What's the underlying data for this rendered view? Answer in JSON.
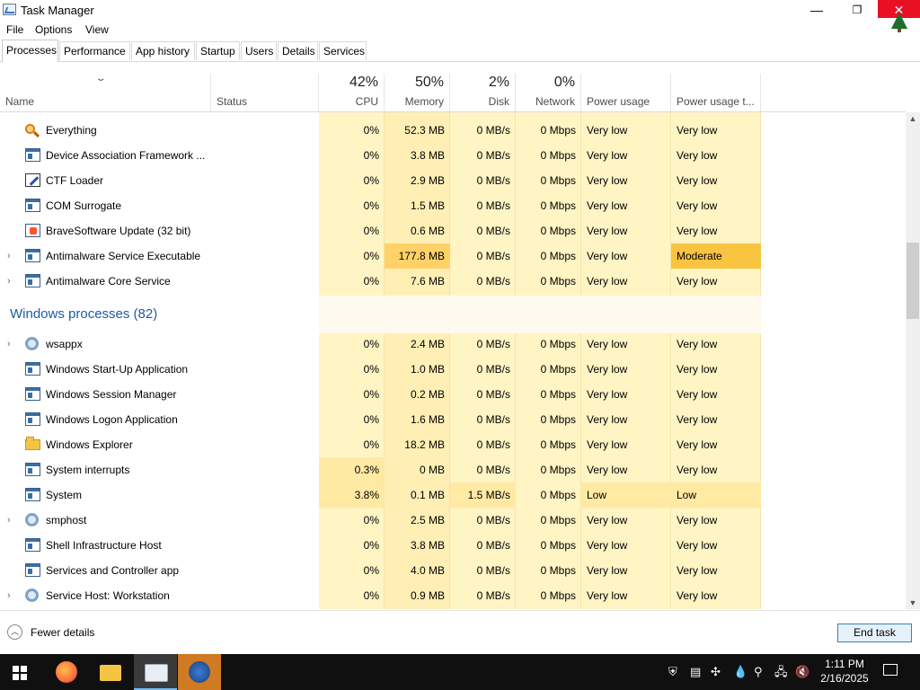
{
  "window": {
    "title": "Task Manager",
    "minimize": "—",
    "maximize": "❐",
    "close": "✕"
  },
  "menu": [
    "File",
    "Options",
    "View"
  ],
  "tabs": [
    "Processes",
    "Performance",
    "App history",
    "Startup",
    "Users",
    "Details",
    "Services"
  ],
  "active_tab": "Processes",
  "columns": {
    "name": "Name",
    "status": "Status",
    "cpu": {
      "pct": "42%",
      "label": "CPU"
    },
    "memory": {
      "pct": "50%",
      "label": "Memory"
    },
    "disk": {
      "pct": "2%",
      "label": "Disk"
    },
    "network": {
      "pct": "0%",
      "label": "Network"
    },
    "power": "Power usage",
    "power_trend": "Power usage t..."
  },
  "rows": [
    {
      "expand": false,
      "icon": "search-icon",
      "name": "Everything",
      "cpu": "0%",
      "mem": "52.3 MB",
      "disk": "0 MB/s",
      "net": "0 Mbps",
      "power": "Very low",
      "trend": "Very low"
    },
    {
      "expand": false,
      "icon": "window-icon",
      "name": "Device Association Framework ...",
      "cpu": "0%",
      "mem": "3.8 MB",
      "disk": "0 MB/s",
      "net": "0 Mbps",
      "power": "Very low",
      "trend": "Very low"
    },
    {
      "expand": false,
      "icon": "edit-icon",
      "name": "CTF Loader",
      "cpu": "0%",
      "mem": "2.9 MB",
      "disk": "0 MB/s",
      "net": "0 Mbps",
      "power": "Very low",
      "trend": "Very low"
    },
    {
      "expand": false,
      "icon": "window-icon",
      "name": "COM Surrogate",
      "cpu": "0%",
      "mem": "1.5 MB",
      "disk": "0 MB/s",
      "net": "0 Mbps",
      "power": "Very low",
      "trend": "Very low"
    },
    {
      "expand": false,
      "icon": "brave-icon",
      "name": "BraveSoftware Update (32 bit)",
      "cpu": "0%",
      "mem": "0.6 MB",
      "disk": "0 MB/s",
      "net": "0 Mbps",
      "power": "Very low",
      "trend": "Very low"
    },
    {
      "expand": true,
      "icon": "window-icon",
      "name": "Antimalware Service Executable",
      "cpu": "0%",
      "mem": "177.8 MB",
      "disk": "0 MB/s",
      "net": "0 Mbps",
      "power": "Very low",
      "trend": "Moderate"
    },
    {
      "expand": true,
      "icon": "window-icon",
      "name": "Antimalware Core Service",
      "cpu": "0%",
      "mem": "7.6 MB",
      "disk": "0 MB/s",
      "net": "0 Mbps",
      "power": "Very low",
      "trend": "Very low"
    }
  ],
  "group": {
    "title": "Windows processes (82)"
  },
  "rows2": [
    {
      "expand": true,
      "icon": "gear-icon",
      "name": "wsappx",
      "cpu": "0%",
      "mem": "2.4 MB",
      "disk": "0 MB/s",
      "net": "0 Mbps",
      "power": "Very low",
      "trend": "Very low"
    },
    {
      "expand": false,
      "icon": "window-icon",
      "name": "Windows Start-Up Application",
      "cpu": "0%",
      "mem": "1.0 MB",
      "disk": "0 MB/s",
      "net": "0 Mbps",
      "power": "Very low",
      "trend": "Very low"
    },
    {
      "expand": false,
      "icon": "window-icon",
      "name": "Windows Session Manager",
      "cpu": "0%",
      "mem": "0.2 MB",
      "disk": "0 MB/s",
      "net": "0 Mbps",
      "power": "Very low",
      "trend": "Very low"
    },
    {
      "expand": false,
      "icon": "window-icon",
      "name": "Windows Logon Application",
      "cpu": "0%",
      "mem": "1.6 MB",
      "disk": "0 MB/s",
      "net": "0 Mbps",
      "power": "Very low",
      "trend": "Very low"
    },
    {
      "expand": false,
      "icon": "folder-icon",
      "name": "Windows Explorer",
      "cpu": "0%",
      "mem": "18.2 MB",
      "disk": "0 MB/s",
      "net": "0 Mbps",
      "power": "Very low",
      "trend": "Very low"
    },
    {
      "expand": false,
      "icon": "window-icon",
      "name": "System interrupts",
      "cpu": "0.3%",
      "mem": "0 MB",
      "disk": "0 MB/s",
      "net": "0 Mbps",
      "power": "Very low",
      "trend": "Very low"
    },
    {
      "expand": false,
      "icon": "window-icon",
      "name": "System",
      "cpu": "3.8%",
      "mem": "0.1 MB",
      "disk": "1.5 MB/s",
      "net": "0 Mbps",
      "power": "Low",
      "trend": "Low"
    },
    {
      "expand": true,
      "icon": "gear-icon",
      "name": "smphost",
      "cpu": "0%",
      "mem": "2.5 MB",
      "disk": "0 MB/s",
      "net": "0 Mbps",
      "power": "Very low",
      "trend": "Very low"
    },
    {
      "expand": false,
      "icon": "window-icon",
      "name": "Shell Infrastructure Host",
      "cpu": "0%",
      "mem": "3.8 MB",
      "disk": "0 MB/s",
      "net": "0 Mbps",
      "power": "Very low",
      "trend": "Very low"
    },
    {
      "expand": false,
      "icon": "window-icon",
      "name": "Services and Controller app",
      "cpu": "0%",
      "mem": "4.0 MB",
      "disk": "0 MB/s",
      "net": "0 Mbps",
      "power": "Very low",
      "trend": "Very low"
    },
    {
      "expand": true,
      "icon": "gear-icon",
      "name": "Service Host: Workstation",
      "cpu": "0%",
      "mem": "0.9 MB",
      "disk": "0 MB/s",
      "net": "0 Mbps",
      "power": "Very low",
      "trend": "Very low"
    }
  ],
  "footer": {
    "fewer_details": "Fewer details",
    "end_task": "End task"
  },
  "taskbar": {
    "apps": [
      "firefox-icon",
      "file-explorer-icon",
      "task-manager-icon",
      "app-icon"
    ],
    "clock_time": "1:11 PM",
    "clock_date": "2/16/2025"
  },
  "colors": {
    "heat_light": "#fff4c4",
    "heat_mid": "#ffe9a3",
    "heat_moderate": "#ffd166",
    "heat_trend_moderate": "#f9c440",
    "group_title": "#1f5aa6",
    "close_button": "#e81123"
  }
}
